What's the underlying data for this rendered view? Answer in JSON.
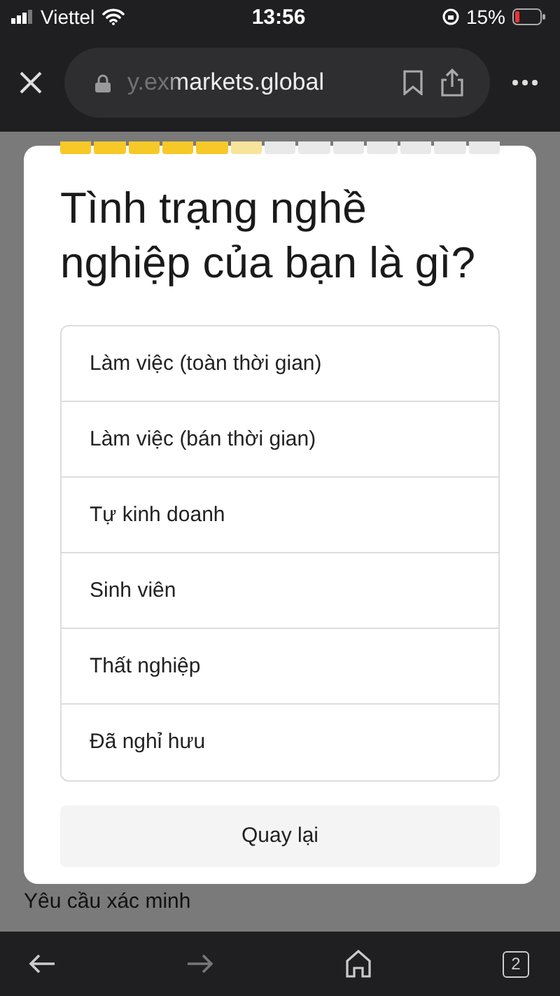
{
  "status_bar": {
    "carrier": "Viettel",
    "time": "13:56",
    "battery": "15%"
  },
  "browser": {
    "url": "y.exmarkets.global",
    "tabs_count": "2"
  },
  "progress": {
    "segments": [
      {
        "done": true,
        "selected": false
      },
      {
        "done": true,
        "selected": false
      },
      {
        "done": true,
        "selected": false
      },
      {
        "done": true,
        "selected": false
      },
      {
        "done": true,
        "selected": false
      },
      {
        "done": false,
        "selected": true
      },
      {
        "done": false,
        "selected": false
      },
      {
        "done": false,
        "selected": false
      },
      {
        "done": false,
        "selected": false
      },
      {
        "done": false,
        "selected": false
      },
      {
        "done": false,
        "selected": false
      },
      {
        "done": false,
        "selected": false
      },
      {
        "done": false,
        "selected": false
      }
    ]
  },
  "question": "Tình trạng nghề nghiệp của bạn là gì?",
  "options": [
    {
      "label": "Làm việc (toàn thời gian)"
    },
    {
      "label": "Làm việc (bán thời gian)"
    },
    {
      "label": "Tự kinh doanh"
    },
    {
      "label": "Sinh viên"
    },
    {
      "label": "Thất nghiệp"
    },
    {
      "label": "Đã nghỉ hưu"
    }
  ],
  "back_button": "Quay lại",
  "background_heading": "Yêu cầu xác minh"
}
